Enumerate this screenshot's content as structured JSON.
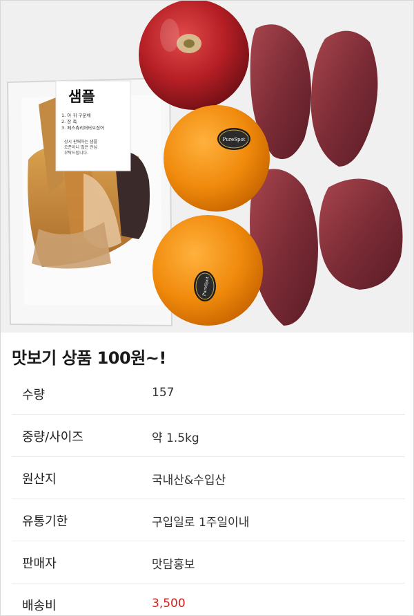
{
  "product_image": {
    "sample_card": {
      "title": "샘플",
      "lines": [
        "1. 아 귀       구운채",
        "2. 장              족",
        "3. 페스츄리버터오징어"
      ],
      "note": [
        "상시 판매하는 샘플",
        "오픈이니 많은 관심",
        "부탁드립니다."
      ]
    },
    "sticker_text_1": "PureSpot",
    "sticker_text_2": "PureSpot"
  },
  "product": {
    "title": "맛보기 상품 100원~!"
  },
  "details": [
    {
      "label": "수량",
      "value": "157"
    },
    {
      "label": "중량/사이즈",
      "value": "약 1.5kg"
    },
    {
      "label": "원산지",
      "value": "국내산&수입산"
    },
    {
      "label": "유통기한",
      "value": "구입일로 1주일이내"
    },
    {
      "label": "판매자",
      "value": "맛담홍보"
    },
    {
      "label": "배송비",
      "value": "3,500"
    }
  ],
  "colors": {
    "shipping_fee": "#d0201c"
  }
}
